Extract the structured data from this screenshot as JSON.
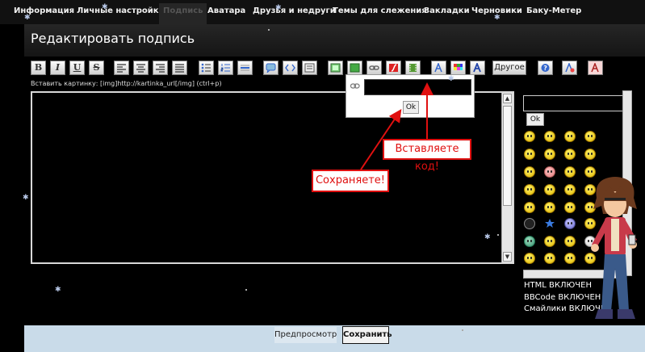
{
  "tabs": [
    "Информация",
    "Личные настройки",
    "Подпись",
    "Аватара",
    "Друзья и недруги",
    "Темы для слежения",
    "Закладки",
    "Черновики",
    "Баку-Метер"
  ],
  "active_tab": "Подпись",
  "page_title": "Редактировать подпись",
  "toolbar": {
    "bold_label": "B",
    "italic_label": "I",
    "underline_label": "U",
    "strike_label": "S",
    "other_label": "Другое"
  },
  "image_hint": "Вставить картинку: [img]http://kartinka_url[/img] (ctrl+p)",
  "popup": {
    "input_value": "",
    "ok_label": "Ok"
  },
  "callouts": {
    "paste_code": "Вставляете код!",
    "save": "Сохраняете!"
  },
  "smilies_panel": {
    "input_value": "",
    "ok_label": "Ok"
  },
  "status": {
    "html": "HTML ВКЛЮЧЕН",
    "bbcode": "BBCode ВКЛЮЧЕН",
    "smilies": "Смайлики ВКЛЮЧЕ"
  },
  "buttons": {
    "preview": "Предпросмотр",
    "save": "Сохранить"
  },
  "colors": {
    "callout_red": "#e01010",
    "bottom_bar": "#c9dbe9",
    "background": "#000000"
  }
}
